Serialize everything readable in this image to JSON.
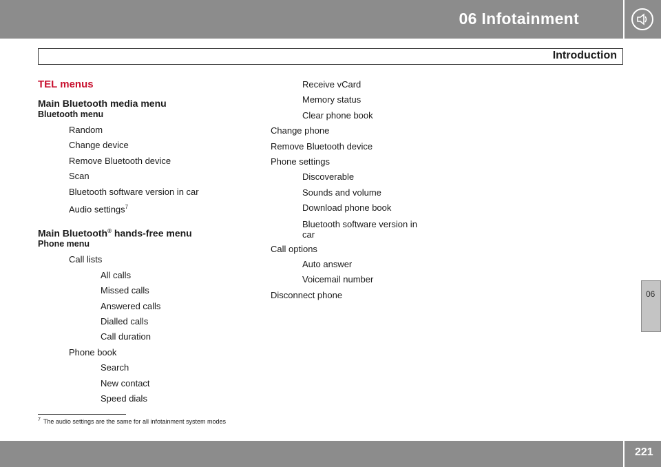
{
  "header": {
    "chapter_title": "06 Infotainment",
    "chapter_icon": "speaker-icon",
    "section_title": "Introduction",
    "side_tab": "06",
    "page_number": "221"
  },
  "main": {
    "heading": "TEL menus",
    "media_menu": {
      "title": "Main Bluetooth media menu",
      "subtitle": "Bluetooth menu",
      "items": [
        "Random",
        "Change device",
        "Remove Bluetooth device",
        "Scan",
        "Bluetooth software version in car"
      ],
      "audio_settings": "Audio settings",
      "audio_settings_note": "7"
    },
    "handsfree_menu": {
      "title_part1": "Main Bluetooth",
      "title_mark": "®",
      "title_part2": " hands-free menu",
      "subtitle": "Phone menu",
      "call_lists": {
        "label": "Call lists",
        "items": [
          "All calls",
          "Missed calls",
          "Answered calls",
          "Dialled calls",
          "Call duration"
        ]
      },
      "phone_book": {
        "label": "Phone book",
        "items": [
          "Search",
          "New contact",
          "Speed dials",
          "Receive vCard",
          "Memory status",
          "Clear phone book"
        ]
      },
      "change_phone": "Change phone",
      "remove_device": "Remove Bluetooth device",
      "phone_settings": {
        "label": "Phone settings",
        "items": [
          "Discoverable",
          "Sounds and volume",
          "Download phone book",
          "Bluetooth software version in car"
        ]
      },
      "call_options": {
        "label": "Call options",
        "items": [
          "Auto answer",
          "Voicemail number"
        ]
      },
      "disconnect": "Disconnect phone"
    }
  },
  "footnote": {
    "number": "7",
    "text": "The audio settings are the same for all infotainment system modes"
  }
}
